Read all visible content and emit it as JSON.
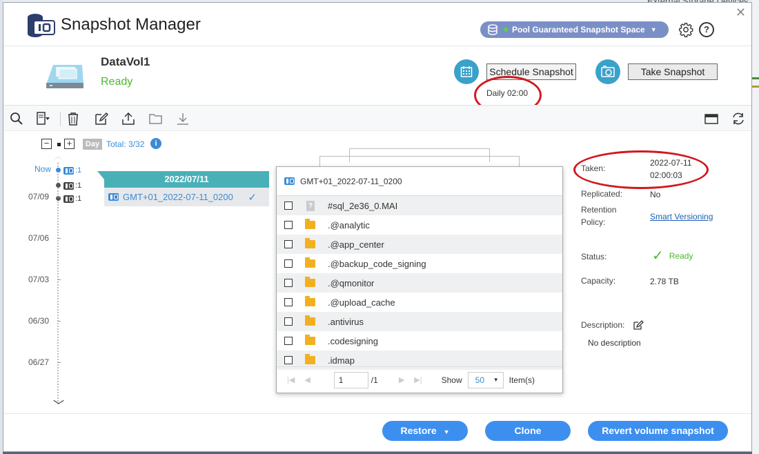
{
  "window": {
    "title": "Snapshot Manager",
    "pool_button": "Pool Guaranteed Snapshot Space",
    "background_text": "External Storage Devices"
  },
  "volume": {
    "name": "DataVol1",
    "status": "Ready",
    "schedule_label": "Schedule Snapshot",
    "schedule_time": "Daily 02:00",
    "take_label": "Take Snapshot"
  },
  "timeline": {
    "day_badge": "Day",
    "total": "Total: 3/32",
    "now": "Now",
    "dates": [
      "07/09",
      "07/06",
      "07/03",
      "06/30",
      "06/27"
    ],
    "snap_counts": [
      ":1",
      ":1",
      ":1"
    ]
  },
  "day_card": {
    "date": "2022/07/11",
    "snapshot_name": "GMT+01_2022-07-11_0200"
  },
  "file_browser": {
    "title": "GMT+01_2022-07-11_0200",
    "files": [
      {
        "name": "#sql_2e36_0.MAI",
        "type": "file"
      },
      {
        "name": ".@analytic",
        "type": "folder"
      },
      {
        "name": ".@app_center",
        "type": "folder"
      },
      {
        "name": ".@backup_code_signing",
        "type": "folder"
      },
      {
        "name": ".@qmonitor",
        "type": "folder"
      },
      {
        "name": ".@upload_cache",
        "type": "folder"
      },
      {
        "name": ".antivirus",
        "type": "folder"
      },
      {
        "name": ".codesigning",
        "type": "folder"
      },
      {
        "name": ".idmap",
        "type": "folder"
      }
    ],
    "page": "1",
    "page_total": "/1",
    "show_label": "Show",
    "per_page": "50",
    "items_label": "Item(s)"
  },
  "properties": {
    "taken_label": "Taken:",
    "taken_date": "2022-07-11",
    "taken_time": "02:00:03",
    "replicated_label": "Replicated:",
    "replicated_value": "No",
    "retention_label_1": "Retention",
    "retention_label_2": "Policy:",
    "retention_value": "Smart Versioning",
    "status_label": "Status:",
    "status_value": "Ready",
    "capacity_label": "Capacity:",
    "capacity_value": "2.78 TB",
    "description_label": "Description:",
    "description_value": "No description"
  },
  "footer": {
    "restore": "Restore",
    "clone": "Clone",
    "revert": "Revert volume snapshot"
  },
  "colors": {
    "accent": "#3d8fef",
    "teal": "#49b0b8",
    "ready_green": "#4cb82e",
    "annotation_red": "#d0191f"
  }
}
